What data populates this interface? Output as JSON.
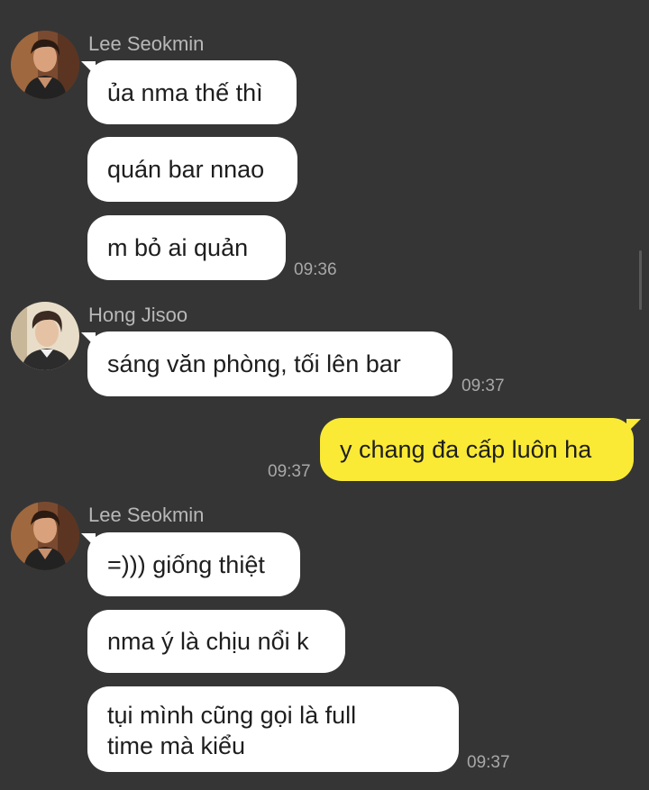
{
  "colors": {
    "background": "#353535",
    "incoming_bubble": "#ffffff",
    "outgoing_bubble": "#fbea35",
    "sender_name": "#b8b8b8",
    "timestamp": "#a8a8a8"
  },
  "groups": [
    {
      "sender": "Lee Seokmin",
      "avatar": "avatar-icon",
      "messages": [
        {
          "text": "ủa nma thế thì"
        },
        {
          "text": "quán bar nnao"
        },
        {
          "text": "m bỏ ai quản",
          "time": "09:36"
        }
      ]
    },
    {
      "sender": "Hong Jisoo",
      "avatar": "avatar-icon",
      "messages": [
        {
          "text": "sáng văn phòng, tối lên bar",
          "time": "09:37"
        }
      ]
    },
    {
      "sender": "",
      "outgoing": true,
      "messages": [
        {
          "text": "y chang đa cấp luôn ha",
          "time": "09:37"
        }
      ]
    },
    {
      "sender": "Lee Seokmin",
      "avatar": "avatar-icon",
      "messages": [
        {
          "text": "=))) giống thiệt"
        },
        {
          "text": "nma ý là chịu nổi k"
        },
        {
          "text": "tụi mình cũng gọi là full time mà kiểu",
          "time": "09:37"
        }
      ]
    }
  ]
}
